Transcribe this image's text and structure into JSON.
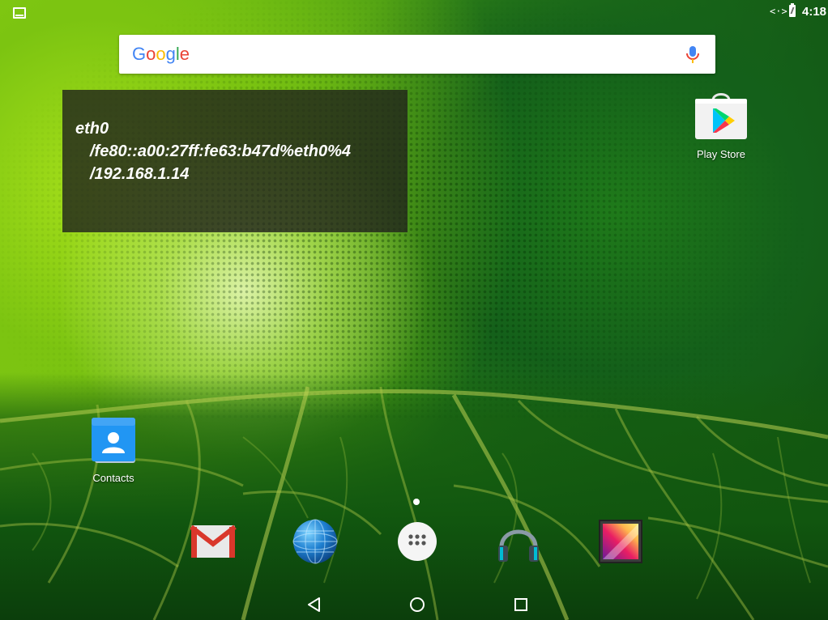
{
  "status_bar": {
    "left_icon": "screenshot-window-icon",
    "network_symbol": "<·>",
    "network_icon": "ethernet-icon",
    "battery_icon": "battery-charging-icon",
    "time": "4:18"
  },
  "search_bar": {
    "logo_letters": [
      "G",
      "o",
      "o",
      "g",
      "l",
      "e"
    ],
    "logo_colors": [
      "#4285F4",
      "#EA4335",
      "#FBBC05",
      "#4285F4",
      "#34A853",
      "#EA4335"
    ],
    "mic_icon": "microphone-icon"
  },
  "ip_widget": {
    "interface": "eth0",
    "ipv6": "/fe80::a00:27ff:fe63:b47d%eth0%4",
    "ipv4": "/192.168.1.14"
  },
  "home_apps": [
    {
      "label": "Play Store",
      "icon": "play-store-icon"
    },
    {
      "label": "Contacts",
      "icon": "contacts-icon"
    }
  ],
  "dock": [
    {
      "icon": "gmail-icon"
    },
    {
      "icon": "browser-globe-icon"
    },
    {
      "icon": "app-drawer-icon"
    },
    {
      "icon": "music-headphones-icon"
    },
    {
      "icon": "gallery-icon"
    }
  ],
  "nav_bar": {
    "back_icon": "back-triangle-icon",
    "home_icon": "home-circle-icon",
    "recents_icon": "recents-square-icon"
  },
  "colors": {
    "accent_green": "#4fa414",
    "widget_bg": "#22261c",
    "text_white": "#ffffff"
  }
}
